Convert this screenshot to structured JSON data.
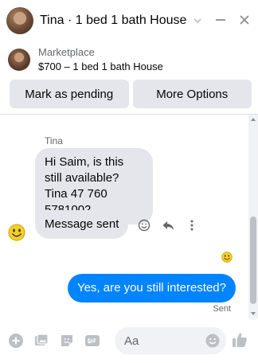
{
  "header": {
    "title": "Tina · 1 bed 1 bath House",
    "avatar_icon": "user-avatar",
    "chevron_icon": "chevron-down-icon",
    "minimize_icon": "minimize-icon",
    "close_icon": "close-icon"
  },
  "listing": {
    "label": "Marketplace",
    "title": "$700 – 1 bed 1 bath House"
  },
  "actions": {
    "mark_pending": "Mark as pending",
    "more_options": "More Options"
  },
  "thread": {
    "sender_name": "Tina",
    "messages_in": [
      "Hi Saim, is this still available? Tina 47 760 5781002",
      "Message sent"
    ],
    "message_out": "Yes, are you still interested?",
    "status": "Sent"
  },
  "composer": {
    "placeholder": "Aa",
    "value": ""
  },
  "colors": {
    "accent": "#0084ff",
    "bubble_in": "#e4e6eb",
    "icon": "#8a8d91"
  }
}
